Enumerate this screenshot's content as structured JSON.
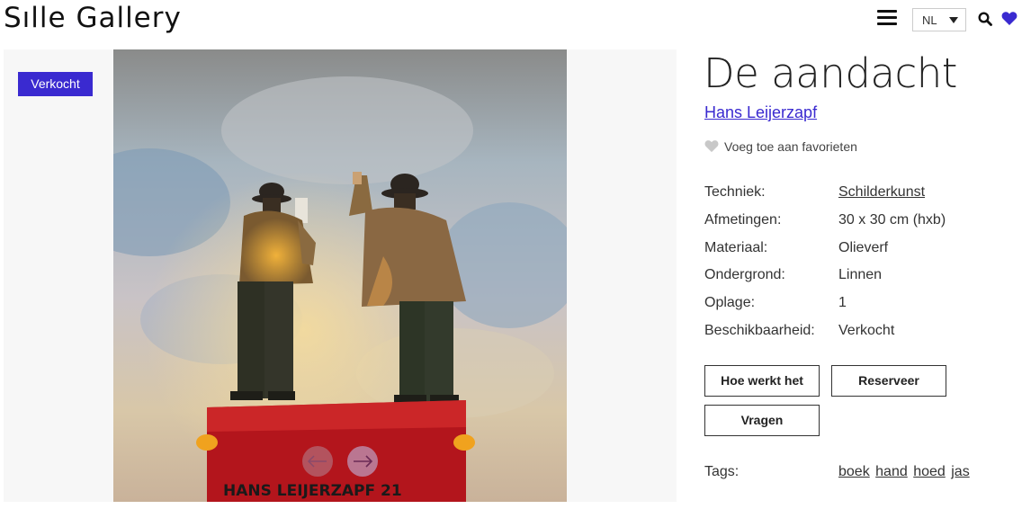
{
  "header": {
    "logo": "Sılle Gallery",
    "language": "NL",
    "icons": {
      "menu": "hamburger-icon",
      "search": "search-icon",
      "favorites": "heart-icon"
    },
    "accent_color": "#3a2ad0"
  },
  "gallery": {
    "badge": "Verkocht",
    "signature": "HANS LEIJERZAPF 21",
    "prev_icon": "arrow-left-icon",
    "next_icon": "arrow-right-icon"
  },
  "artwork": {
    "title": "De aandacht",
    "artist": "Hans Leijerzapf",
    "favorite_label": "Voeg toe aan favorieten",
    "specs": [
      {
        "label": "Techniek:",
        "value": "Schilderkunst",
        "link": true
      },
      {
        "label": "Afmetingen:",
        "value": "30 x 30 cm (hxb)",
        "link": false
      },
      {
        "label": "Materiaal:",
        "value": "Olieverf",
        "link": false
      },
      {
        "label": "Ondergrond:",
        "value": "Linnen",
        "link": false
      },
      {
        "label": "Oplage:",
        "value": "1",
        "link": false
      },
      {
        "label": "Beschikbaarheid:",
        "value": "Verkocht",
        "link": false
      }
    ],
    "buttons": {
      "how": "Hoe werkt het",
      "reserve": "Reserveer",
      "ask": "Vragen"
    },
    "tags_label": "Tags:",
    "tags": [
      "boek",
      "hand",
      "hoed",
      "jas"
    ]
  }
}
